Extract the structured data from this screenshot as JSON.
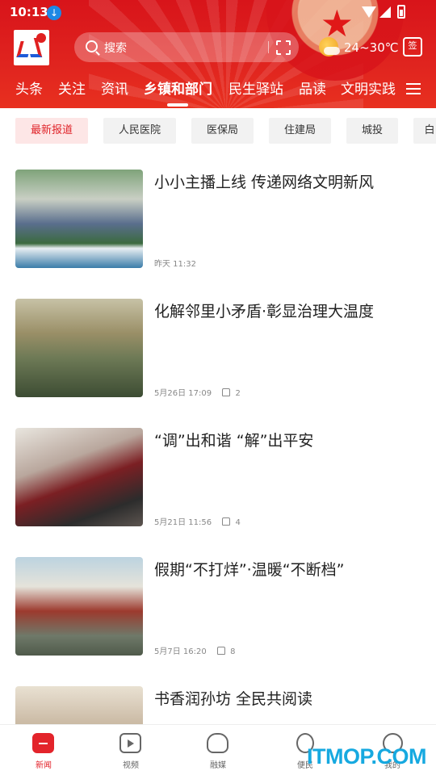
{
  "status": {
    "time": "10:13"
  },
  "header": {
    "search_placeholder": "搜索",
    "temperature": "24~30℃",
    "sign_label": "签"
  },
  "tabs": [
    {
      "label": "头条"
    },
    {
      "label": "关注"
    },
    {
      "label": "资讯"
    },
    {
      "label": "乡镇和部门",
      "active": true
    },
    {
      "label": "民生驿站"
    },
    {
      "label": "品读"
    },
    {
      "label": "文明实践"
    }
  ],
  "chips": [
    {
      "label": "最新报道",
      "active": true
    },
    {
      "label": "人民医院"
    },
    {
      "label": "医保局"
    },
    {
      "label": "住建局"
    },
    {
      "label": "城投"
    },
    {
      "label": "白"
    }
  ],
  "articles": [
    {
      "title": "小小主播上线 传递网络文明新风",
      "date": "昨天 11:32",
      "likes": ""
    },
    {
      "title": "化解邻里小矛盾·彰显治理大温度",
      "date": "5月26日 17:09",
      "likes": "2"
    },
    {
      "title": "“调”出和谐 “解”出平安",
      "date": "5月21日 11:56",
      "likes": "4"
    },
    {
      "title": "假期“不打烊”·温暖“不断档”",
      "date": "5月7日 16:20",
      "likes": "8"
    },
    {
      "title": "书香润孙坊 全民共阅读",
      "date": "",
      "likes": ""
    }
  ],
  "bottom_nav": [
    {
      "label": "新闻",
      "icon": "news-icon",
      "active": true
    },
    {
      "label": "视频",
      "icon": "video-icon"
    },
    {
      "label": "融媒",
      "icon": "media-icon"
    },
    {
      "label": "便民",
      "icon": "service-icon"
    },
    {
      "label": "我的",
      "icon": "profile-icon"
    }
  ],
  "watermark": "ITMOP.COM",
  "colors": {
    "brand_red": "#e3242b",
    "chip_active_bg": "#fde6e6",
    "watermark": "#16a9e0"
  }
}
